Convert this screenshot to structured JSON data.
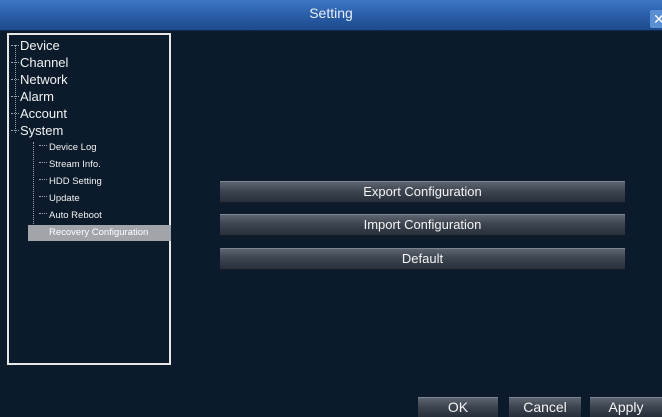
{
  "window": {
    "title": "Setting",
    "close_glyph": "✕"
  },
  "tree": {
    "top_items": [
      {
        "label": "Device"
      },
      {
        "label": "Channel"
      },
      {
        "label": "Network"
      },
      {
        "label": "Alarm"
      },
      {
        "label": "Account"
      },
      {
        "label": "System"
      }
    ],
    "system_children": [
      {
        "label": "Device Log"
      },
      {
        "label": "Stream Info."
      },
      {
        "label": "HDD Setting"
      },
      {
        "label": "Update"
      },
      {
        "label": "Auto Reboot"
      },
      {
        "label": "Recovery Configuration",
        "selected": true
      }
    ]
  },
  "actions": {
    "export_label": "Export Configuration",
    "import_label": "Import Configuration",
    "default_label": "Default"
  },
  "footer": {
    "ok_label": "OK",
    "cancel_label": "Cancel",
    "apply_label": "Apply"
  },
  "colors": {
    "background": "#0b1b2b",
    "titlebar": "#2a5ea9",
    "selected_row": "#a1a4a9"
  }
}
